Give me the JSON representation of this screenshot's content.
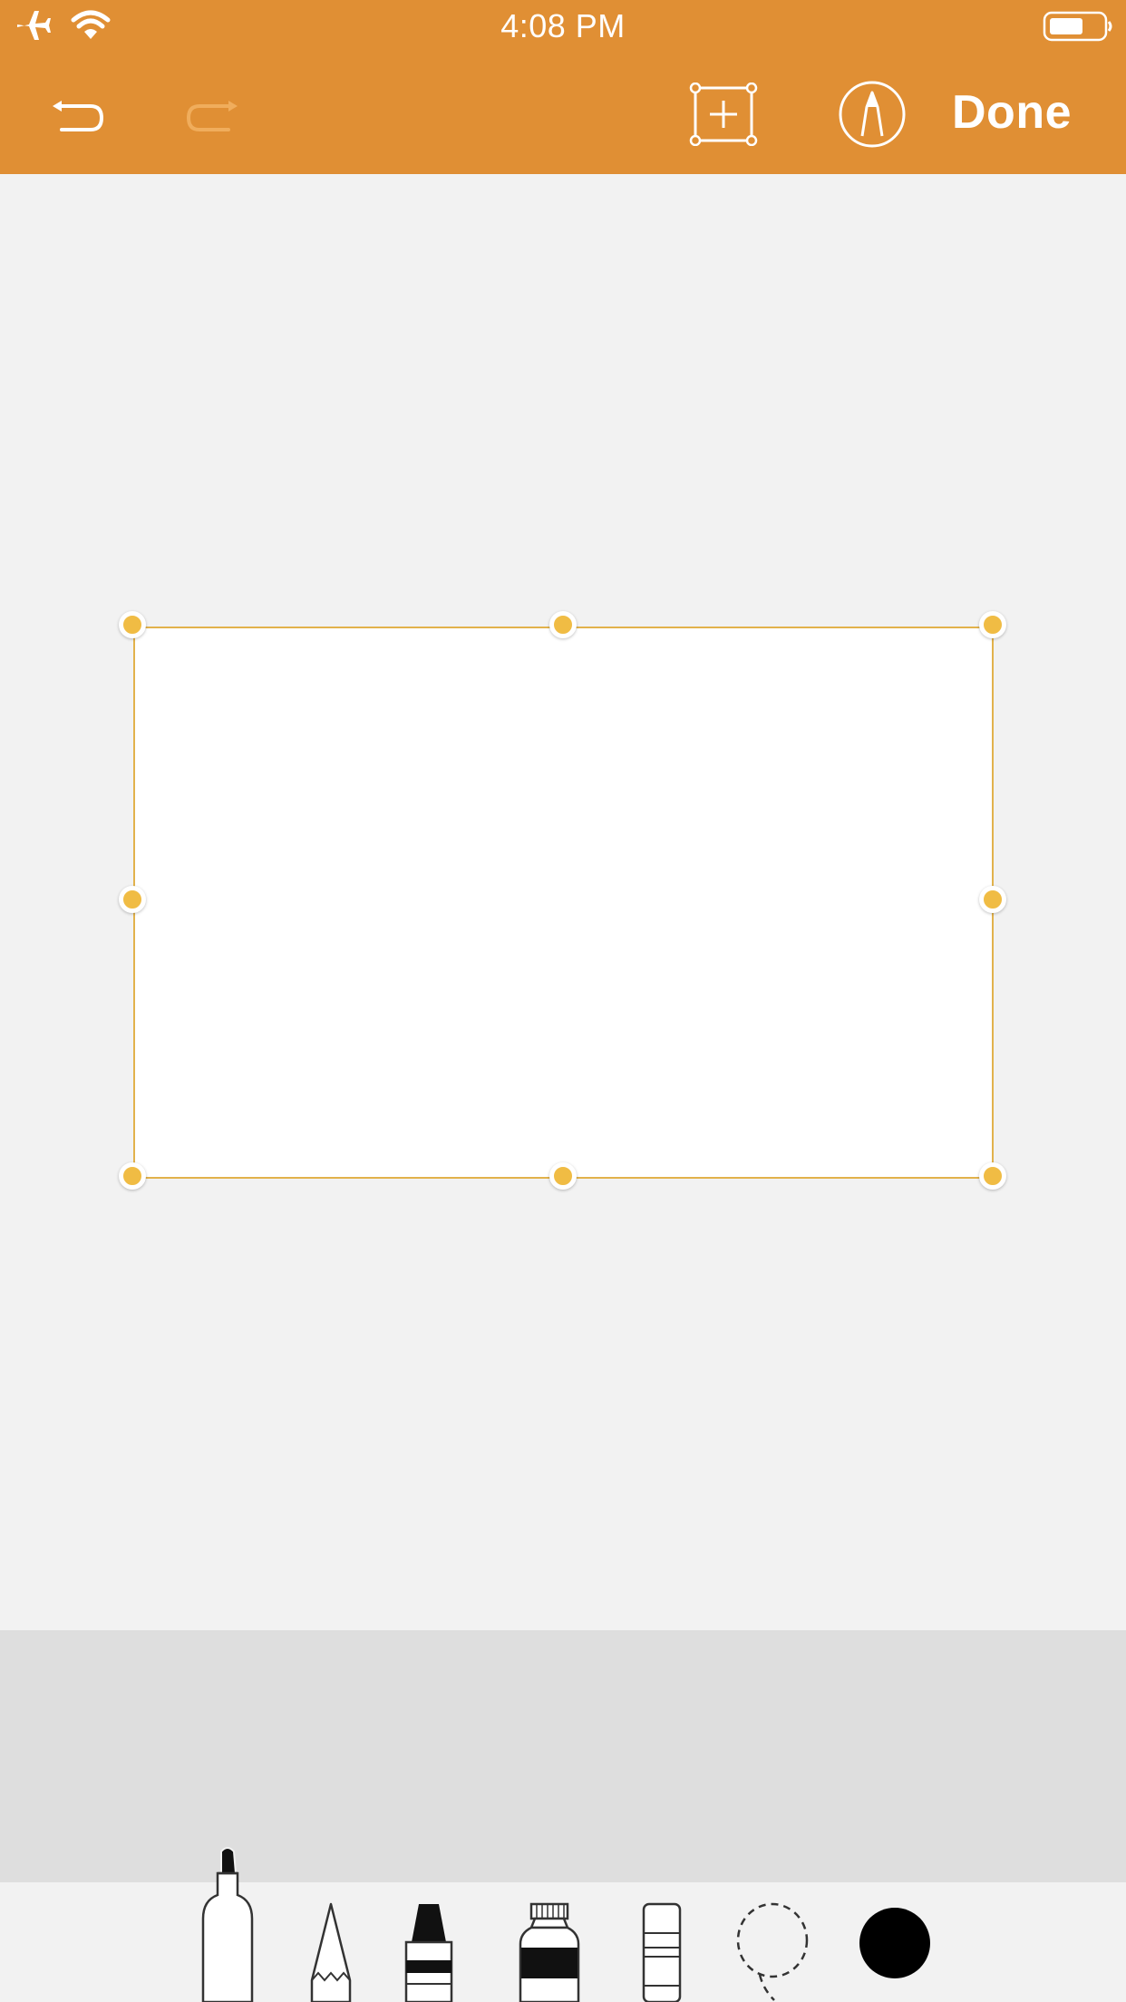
{
  "status_bar": {
    "time": "4:08 PM",
    "left_icons": [
      "airplane-icon",
      "wifi-icon"
    ],
    "right_icons": [
      "battery-icon"
    ]
  },
  "toolbar": {
    "undo_icon": "undo-icon",
    "redo_icon": "redo-icon",
    "add_frame_icon": "add-frame-icon",
    "markup_icon": "pen-circle-icon",
    "done_label": "Done"
  },
  "canvas": {
    "frame_handles": 8
  },
  "tools": {
    "items": [
      "marker-icon",
      "pencil-icon",
      "crayon-icon",
      "paint-tube-icon",
      "eraser-icon",
      "lasso-icon"
    ],
    "selected": "marker-icon",
    "current_color": "#000000"
  },
  "colors": {
    "accent": "#e08f34",
    "handle": "#f0bc44",
    "frame_border": "#e2b24c",
    "canvas_bg": "#f2f2f2",
    "tray_bg": "#dedede"
  }
}
